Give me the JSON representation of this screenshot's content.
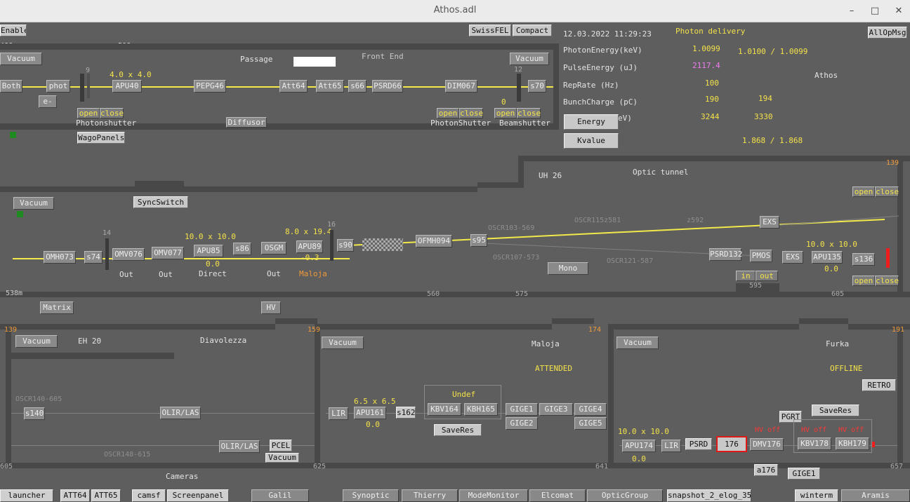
{
  "window": {
    "title": "Athos.adl"
  },
  "top": {
    "enable": "Enable",
    "swissfel": "SwissFEL",
    "compact": "Compact",
    "allopmsg": "AllOpMsg",
    "dist_466": "466m",
    "dist_506": "506m"
  },
  "frontend": {
    "passage": "Passage",
    "front_end": "Front End",
    "vacuum_left": "Vacuum",
    "vacuum_right": "Vacuum",
    "both": "Both",
    "phot": "phot",
    "e_minus": "e-",
    "num9": "9",
    "num12": "12",
    "apu40": "APU40",
    "apu40_size": "4.0 x 4.0",
    "pepg46": "PEPG46",
    "att64": "Att64",
    "att65": "Att65",
    "s66": "s66",
    "psrd66": "PSRD66",
    "dim067": "DIM067",
    "s70": "s70",
    "zero": "0",
    "open": "open",
    "close": "close",
    "photonshutter": "Photonshutter",
    "diffusor": "Diffusor",
    "photonshutter2": "PhotonShutter",
    "beamshutter": "Beamshutter",
    "wagopanels": "WagoPanels"
  },
  "status": {
    "datetime": "12.03.2022 11:29:23",
    "mode": "Photon delivery",
    "labels": {
      "photon_energy": "PhotonEnergy(keV)",
      "pulse_energy": "PulseEnergy  (uJ)",
      "rep_rate": "RepRate      (Hz)",
      "bunch_charge": "BunchCharge  (pC)",
      "energy_mev": "eV)"
    },
    "values": {
      "photon_energy": "1.0099",
      "photon_energy_set": "1.0100 / 1.0099",
      "pulse_energy": "2117.4",
      "rep_rate": "100",
      "bunch_charge": "190",
      "bunch_charge2": "194",
      "energy_mev": "3244",
      "energy_mev2": "3330",
      "kvalue": "1.868 / 1.868"
    },
    "athos": "Athos",
    "energy_btn": "Energy",
    "kvalue_btn": "Kvalue"
  },
  "optics": {
    "uh26": "UH 26",
    "optic_tunnel": "Optic tunnel",
    "n139": "139",
    "vacuum": "Vacuum",
    "syncswitch": "SyncSwitch",
    "open": "open",
    "close": "close",
    "n14": "14",
    "n16": "16",
    "omh073": "OMH073",
    "s74": "s74",
    "omv076": "OMV076",
    "omv077": "OMV077",
    "apu85": "APU85",
    "apu85_size": "10.0 x 10.0",
    "apu85_pos": "0.0",
    "s86": "s86",
    "osgm": "OSGM",
    "apu89": "APU89",
    "apu89_size": "8.0 x 19.4",
    "apu89_pos": "-0.3",
    "s90": "s90",
    "ofmh094": "OFMH094",
    "s95": "s95",
    "out1": "Out",
    "out2": "Out",
    "direct": "Direct",
    "out3": "Out",
    "maloja": "Maloja",
    "oscr103": "OSCR103-569",
    "oscr115": "OSCR115z581",
    "z592": "z592",
    "oscr107": "OSCR107-573",
    "oscr121": "OSCR121-587",
    "mono": "Mono",
    "exs_top": "EXS",
    "psrd132": "PSRD132",
    "pmos": "PMOS",
    "exs": "EXS",
    "apu135": "APU135",
    "apu135_size": "10.0 x 10.0",
    "apu135_pos": "0.0",
    "s136": "s136",
    "in": "in",
    "out": "out",
    "m538": "538m",
    "n560": "560",
    "n575": "575",
    "n595": "595",
    "n605": "605",
    "matrix": "Matrix",
    "hv": "HV"
  },
  "eh20": {
    "n139": "139",
    "vacuum": "Vacuum",
    "title": "EH 20",
    "diavolezza": "Diavolezza",
    "oscr140": "OSCR140-605",
    "s140": "s140",
    "olir_las": "OLIR/LAS",
    "olir_las2": "OLIR/LAS",
    "pcel": "PCEL",
    "vacuum2": "Vacuum",
    "oscr148": "OSCR148-615",
    "n605": "605",
    "n625": "625",
    "cameras": "Cameras"
  },
  "maloja": {
    "n159": "159",
    "n174": "174",
    "vacuum": "Vacuum",
    "title": "Maloja",
    "attended": "ATTENDED",
    "undef": "Undef",
    "lir": "LIR",
    "apu161": "APU161",
    "apu161_size": "6.5 x 6.5",
    "apu161_pos": "0.0",
    "s162": "s162",
    "kbv164": "KBV164",
    "kbh165": "KBH165",
    "saveres": "SaveRes",
    "gige1": "GIGE1",
    "gige3": "GIGE3",
    "gige4": "GIGE4",
    "gige2": "GIGE2",
    "gige5": "GIGE5",
    "n641": "641"
  },
  "furka": {
    "n191": "191",
    "vacuum": "Vacuum",
    "title": "Furka",
    "offline": "OFFLINE",
    "retro": "RETRO",
    "pgrt": "PGRT",
    "saveres": "SaveRes",
    "apu174_size": "10.0 x 10.0",
    "apu174": "APU174",
    "apu174_pos": "0.0",
    "lir": "LIR",
    "psrd": "PSRD",
    "n176": "176",
    "dmv176": "DMV176",
    "hv_off1": "HV off",
    "hv_off2": "HV off",
    "hv_off3": "HV off",
    "kbv178": "KBV178",
    "kbh179": "KBH179",
    "a176": "a176",
    "gige1": "GIGE1",
    "n657": "657"
  },
  "taskbar": {
    "launcher": "launcher",
    "att64": "ATT64",
    "att65": "ATT65",
    "camsf": "camsf",
    "screenpanel": "Screenpanel",
    "galil": "Galil",
    "synoptic": "Synoptic",
    "thierry": "Thierry",
    "modemonitor": "ModeMonitor",
    "elcomat": "Elcomat",
    "opticgroup": "OpticGroup",
    "snapshot": "snapshot_2_elog_35",
    "winterm": "winterm",
    "aramis": "Aramis"
  }
}
